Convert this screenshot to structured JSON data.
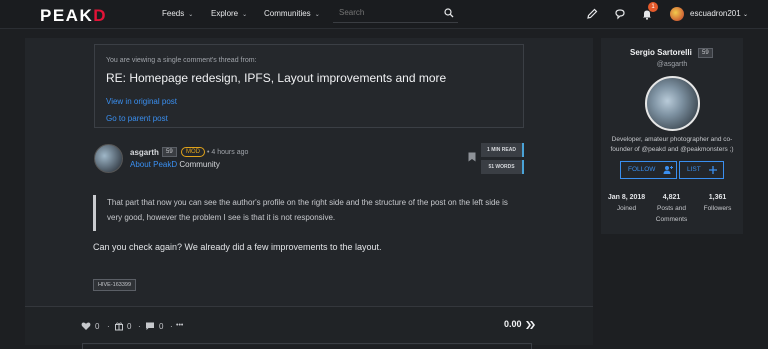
{
  "header": {
    "logo_main": "PEAK",
    "logo_accent": "D",
    "nav": [
      "Feeds",
      "Explore",
      "Communities"
    ],
    "search_placeholder": "Search",
    "notification_count": "1",
    "username": "escuadron201",
    "icons": [
      "pencil-icon",
      "chat-icon",
      "bell-icon",
      "search-icon"
    ]
  },
  "thread": {
    "note": "You are viewing a single comment's thread from:",
    "title": "RE: Homepage redesign, IPFS, Layout improvements and more",
    "link_original": "View in original post",
    "link_parent": "Go to parent post"
  },
  "post": {
    "author": "asgarth",
    "reputation": "59",
    "role_badge": "MOD",
    "time": "• 4 hours ago",
    "community_name": "About PeakD",
    "community_suffix": "Community",
    "read_time": "1 MIN READ",
    "word_count": "51 WORDS",
    "quote": "That part that now you can see the author's profile on the right side and the structure of the post on the left side is very good, however the problem I see is that it is not responsive.",
    "body": "Can you check again? We already did a few improvements to the layout.",
    "tag": "HIVE-163399"
  },
  "footer": {
    "votes": "0",
    "reblogs": "0",
    "comments": "0",
    "payout": "0.00",
    "separator": "·",
    "more": "•••"
  },
  "profile": {
    "name": "Sergio Sartorelli",
    "reputation": "59",
    "handle": "@asgarth",
    "bio": "Developer, amateur photographer and co-founder of @peakd and @peakmonsters ;)",
    "follow_label": "FOLLOW",
    "list_label": "LIST",
    "stats": [
      {
        "value": "Jan 8, 2018",
        "label": "Joined"
      },
      {
        "value": "4,821",
        "label": "Posts and Comments"
      },
      {
        "value": "1,361",
        "label": "Followers"
      }
    ]
  },
  "colors": {
    "accent": "#3a8ff0",
    "brand_red": "#e31337",
    "mod_badge": "#e0a21b",
    "notification": "#e55a2b",
    "background": "#1d1f22",
    "panel": "#23262a"
  }
}
